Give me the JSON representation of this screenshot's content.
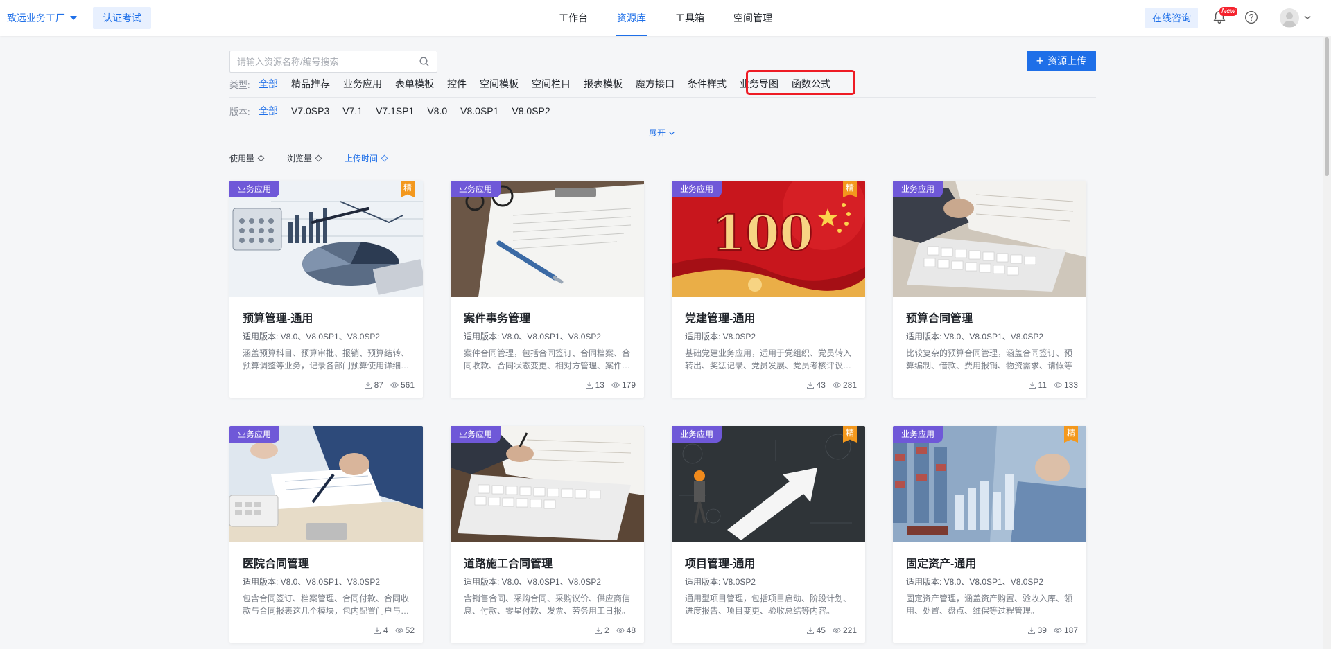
{
  "header": {
    "brand": "致远业务工厂",
    "cert_button": "认证考试",
    "nav": [
      {
        "label": "工作台",
        "active": false
      },
      {
        "label": "资源库",
        "active": true
      },
      {
        "label": "工具箱",
        "active": false
      },
      {
        "label": "空间管理",
        "active": false
      }
    ],
    "consult_button": "在线咨询",
    "new_badge": "New"
  },
  "filters": {
    "search_placeholder": "请输入资源名称/编号搜索",
    "upload_button": "资源上传",
    "type_label": "类型:",
    "types": [
      {
        "label": "全部",
        "active": true
      },
      {
        "label": "精品推荐",
        "active": false
      },
      {
        "label": "业务应用",
        "active": false
      },
      {
        "label": "表单模板",
        "active": false
      },
      {
        "label": "控件",
        "active": false
      },
      {
        "label": "空间模板",
        "active": false
      },
      {
        "label": "空间栏目",
        "active": false
      },
      {
        "label": "报表模板",
        "active": false
      },
      {
        "label": "魔方接口",
        "active": false
      },
      {
        "label": "条件样式",
        "active": false
      },
      {
        "label": "业务导图",
        "active": false
      },
      {
        "label": "函数公式",
        "active": false
      }
    ],
    "version_label": "版本:",
    "versions": [
      {
        "label": "全部",
        "active": true
      },
      {
        "label": "V7.0SP3",
        "active": false
      },
      {
        "label": "V7.1",
        "active": false
      },
      {
        "label": "V7.1SP1",
        "active": false
      },
      {
        "label": "V8.0",
        "active": false
      },
      {
        "label": "V8.0SP1",
        "active": false
      },
      {
        "label": "V8.0SP2",
        "active": false
      }
    ],
    "expand": "展开",
    "sort": [
      {
        "label": "使用量",
        "active": false
      },
      {
        "label": "浏览量",
        "active": false
      },
      {
        "label": "上传时间",
        "active": true
      }
    ]
  },
  "colors": {
    "accent": "#1e6fe8",
    "tag": "#6f58d8",
    "jing_badge": "#f3981d",
    "highlight": "#ee1c25"
  },
  "cards": [
    {
      "tag": "业务应用",
      "jing": "精",
      "title": "预算管理-通用",
      "version": "适用版本:  V8.0、V8.0SP1、V8.0SP2",
      "desc": "涵盖预算科目、预算审批、报销、预算结转、预算调整等业务，记录各部门预算使用详细情况",
      "downloads": "87",
      "views": "561",
      "image": "finance-chart"
    },
    {
      "tag": "业务应用",
      "jing": "",
      "title": "案件事务管理",
      "version": "适用版本:  V8.0、V8.0SP1、V8.0SP2",
      "desc": "案件合同管理，包括合同签订、合同档案、合同收款、合同状态变更、相对方管理、案件管理等",
      "downloads": "13",
      "views": "179",
      "image": "clipboard-pen"
    },
    {
      "tag": "业务应用",
      "jing": "精",
      "title": "党建管理-通用",
      "version": "适用版本:  V8.0SP2",
      "desc": "基础党建业务应用，适用于党组织、党员转入转出、奖惩记录、党员发展、党员考核评议等场景",
      "downloads": "43",
      "views": "281",
      "image": "party-100"
    },
    {
      "tag": "业务应用",
      "jing": "",
      "title": "预算合同管理",
      "version": "适用版本:  V8.0、V8.0SP1、V8.0SP2",
      "desc": "比较复杂的预算合同管理，涵盖合同签订、预算编制、借款、费用报销、物资需求、请假等",
      "downloads": "11",
      "views": "133",
      "image": "hand-keyboard"
    },
    {
      "tag": "业务应用",
      "jing": "",
      "title": "医院合同管理",
      "version": "适用版本:  V8.0、V8.0SP1、V8.0SP2",
      "desc": "包含合同签订、档案管理、合同付款、合同收款与合同报表这几个模块，包内配置门户与报表",
      "downloads": "4",
      "views": "52",
      "image": "signing-desk"
    },
    {
      "tag": "业务应用",
      "jing": "",
      "title": "道路施工合同管理",
      "version": "适用版本:  V8.0、V8.0SP1、V8.0SP2",
      "desc": "含销售合同、采购合同、采购议价、供应商信息、付款、零星付款、发票、劳务用工日报。",
      "downloads": "2",
      "views": "48",
      "image": "hand-writing"
    },
    {
      "tag": "业务应用",
      "jing": "精",
      "title": "项目管理-通用",
      "version": "适用版本:  V8.0SP2",
      "desc": "通用型项目管理，包括项目启动、阶段计划、进度报告、项目变更、验收总结等内容。",
      "downloads": "45",
      "views": "221",
      "image": "arrow-man"
    },
    {
      "tag": "业务应用",
      "jing": "精",
      "title": "固定资产-通用",
      "version": "适用版本:  V8.0、V8.0SP1、V8.0SP2",
      "desc": "固定资产管理，涵盖资产购置、验收入库、领用、处置、盘点、维保等过程管理。",
      "downloads": "39",
      "views": "187",
      "image": "warehouse"
    }
  ]
}
